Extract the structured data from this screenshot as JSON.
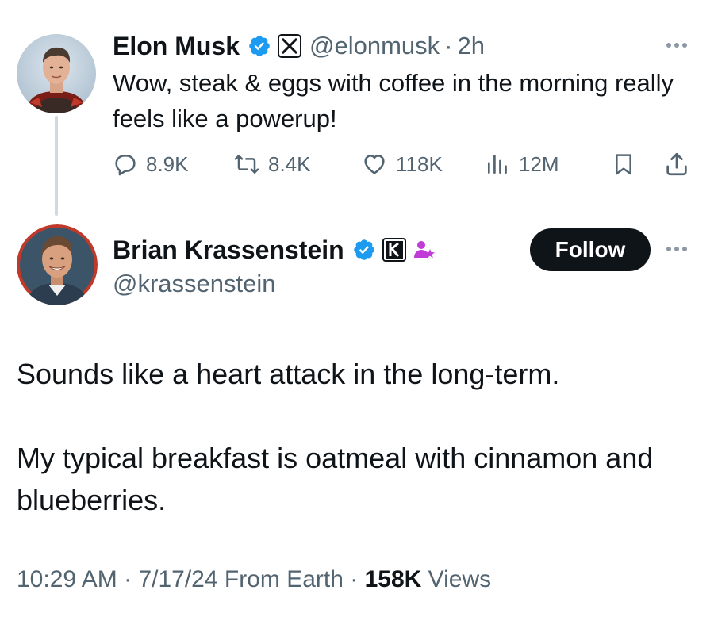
{
  "parent_tweet": {
    "author": {
      "display_name": "Elon Musk",
      "handle": "@elonmusk",
      "verified_badge": "blue-check-badge",
      "affiliate_badge": "x-logo-badge"
    },
    "separator": "·",
    "time_ago": "2h",
    "text": "Wow, steak & eggs with coffee in the morning really feels like a powerup!",
    "metrics": {
      "replies": "8.9K",
      "reposts": "8.4K",
      "likes": "118K",
      "views": "12M"
    },
    "icons": [
      "reply-icon",
      "repost-icon",
      "like-icon",
      "views-icon",
      "bookmark-icon",
      "share-icon",
      "more-icon"
    ]
  },
  "reply_tweet": {
    "author": {
      "display_name": "Brian Krassenstein",
      "handle": "@krassenstein",
      "verified_badge": "blue-check-badge",
      "affiliate_badge": "k-logo-badge",
      "extra_badge": "person-star-badge"
    },
    "follow_label": "Follow",
    "paragraphs": [
      "Sounds like a heart attack in the long-term.",
      "My typical breakfast is oatmeal with cinnamon and blueberries."
    ],
    "meta": {
      "time": "10:29 AM",
      "date": "7/17/24",
      "source": "From Earth",
      "separator": "·",
      "views_count": "158K",
      "views_label": "Views"
    }
  },
  "colors": {
    "text_primary": "#0f1419",
    "text_secondary": "#536471",
    "verified_blue": "#1d9bf0",
    "follow_button_bg": "#0f1419",
    "thread_line": "#cfd9de",
    "badge_purple": "#c13bd9"
  }
}
